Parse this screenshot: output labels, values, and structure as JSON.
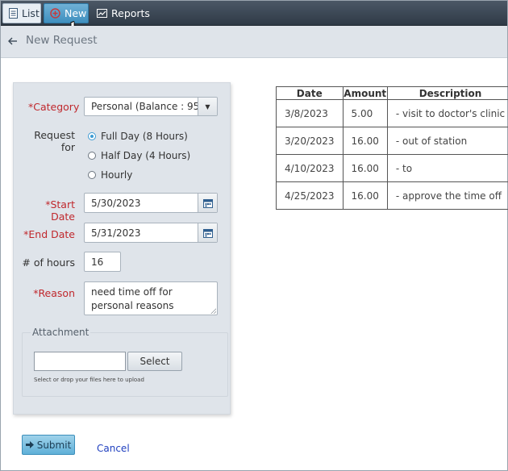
{
  "toolbar": {
    "list_label": "List",
    "new_label": "New",
    "reports_label": "Reports"
  },
  "header": {
    "title": "New Request"
  },
  "form": {
    "category_label": "Category",
    "category_value": "Personal (Balance : 95 ...",
    "request_for_label": "Request for",
    "options": [
      "Full Day (8 Hours)",
      "Half Day (4 Hours)",
      "Hourly"
    ],
    "selected_option": "Full Day (8 Hours)",
    "start_date_label": "Start Date",
    "start_date_value": "5/30/2023",
    "end_date_label": "End Date",
    "end_date_value": "5/31/2023",
    "hours_label": "# of hours",
    "hours_value": "16",
    "reason_label": "Reason",
    "reason_value": "need time off for personal reasons",
    "required_marker": "*"
  },
  "attachment": {
    "title": "Attachment",
    "select_label": "Select",
    "hint": "Select or drop your files here to upload"
  },
  "actions": {
    "submit_label": "Submit",
    "cancel_label": "Cancel"
  },
  "table": {
    "headers": [
      "Date",
      "Amount",
      "Description"
    ],
    "rows": [
      [
        "3/8/2023",
        "5.00",
        "- visit to doctor's clinic"
      ],
      [
        "3/20/2023",
        "16.00",
        "- out of station"
      ],
      [
        "4/10/2023",
        "16.00",
        "- to"
      ],
      [
        "4/25/2023",
        "16.00",
        "- approve the time off"
      ]
    ]
  },
  "colors": {
    "required_red": "#c0282d",
    "accent_blue": "#3d9bd3",
    "link_blue": "#1f3fbf"
  },
  "icons": {
    "list": "list-icon",
    "new": "plus-circle-icon",
    "reports": "chart-icon",
    "back": "arrow-left-icon",
    "dropdown": "triangle-down-icon",
    "calendar": "calendar-icon",
    "submit": "arrow-right-icon",
    "cursor": "hand-pointer-icon"
  }
}
